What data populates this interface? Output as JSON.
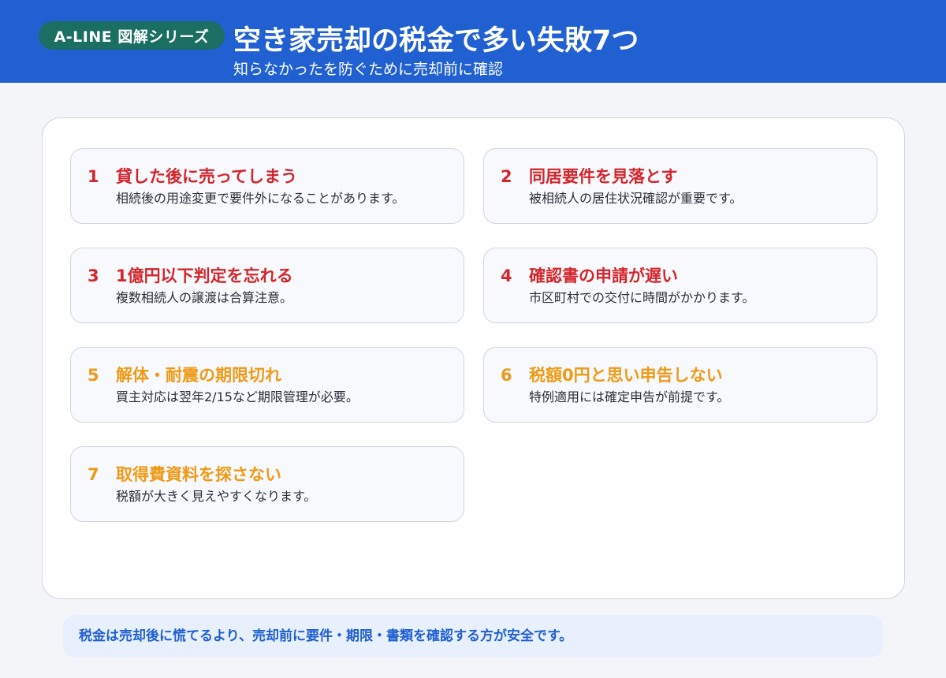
{
  "header": {
    "badge": "A-LINE 図解シリーズ",
    "title": "空き家売却の税金で多い失敗7つ",
    "subtitle": "知らなかったを防ぐために売却前に確認"
  },
  "colors": {
    "header_bg": "#2160d0",
    "badge_bg": "#1b6e62",
    "red": "#d3262c",
    "orange": "#ef9a16",
    "footer_text": "#2160d0"
  },
  "items": [
    {
      "num": "1",
      "title": "貸した後に売ってしまう",
      "desc": "相続後の用途変更で要件外になることがあります。",
      "color": "#d3262c"
    },
    {
      "num": "2",
      "title": "同居要件を見落とす",
      "desc": "被相続人の居住状況確認が重要です。",
      "color": "#d3262c"
    },
    {
      "num": "3",
      "title": "1億円以下判定を忘れる",
      "desc": "複数相続人の譲渡は合算注意。",
      "color": "#d3262c"
    },
    {
      "num": "4",
      "title": "確認書の申請が遅い",
      "desc": "市区町村での交付に時間がかかります。",
      "color": "#d3262c"
    },
    {
      "num": "5",
      "title": "解体・耐震の期限切れ",
      "desc": "買主対応は翌年2/15など期限管理が必要。",
      "color": "#ef9a16"
    },
    {
      "num": "6",
      "title": "税額0円と思い申告しない",
      "desc": "特例適用には確定申告が前提です。",
      "color": "#ef9a16"
    },
    {
      "num": "7",
      "title": "取得費資料を探さない",
      "desc": "税額が大きく見えやすくなります。",
      "color": "#ef9a16"
    }
  ],
  "footer": {
    "text": "税金は売却後に慌てるより、売却前に要件・期限・書類を確認する方が安全です。"
  }
}
